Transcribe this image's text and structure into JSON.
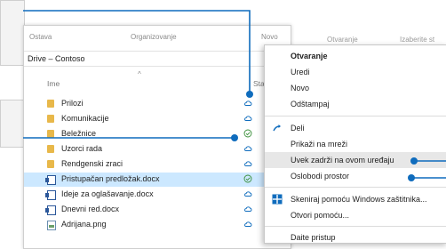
{
  "ribbon": {
    "items": [
      "Ostava",
      "Organizovanje",
      "Novo",
      "Otvaranje",
      "Izaberite st"
    ]
  },
  "address": {
    "path": "Drive – Contoso"
  },
  "columns": {
    "name": "Ime",
    "status": "Status"
  },
  "files": [
    {
      "name": "Prilozi",
      "type": "folder",
      "status": "cloud"
    },
    {
      "name": "Komunikacije",
      "type": "folder",
      "status": "cloud"
    },
    {
      "name": "Beležnice",
      "type": "folder",
      "status": "available"
    },
    {
      "name": "Uzorci rada",
      "type": "folder",
      "status": "cloud"
    },
    {
      "name": "Rendgenski zraci",
      "type": "folder",
      "status": "cloud"
    },
    {
      "name": "Pristupačan predložak.docx",
      "type": "docx",
      "status": "available",
      "selected": true
    },
    {
      "name": "Ideje za oglašavanje.docx",
      "type": "docx",
      "status": "cloud"
    },
    {
      "name": "Dnevni red.docx",
      "type": "docx",
      "status": "cloud"
    },
    {
      "name": "Adrijana.png",
      "type": "png",
      "status": "cloud"
    }
  ],
  "context_menu": {
    "items": [
      {
        "label": "Otvaranje",
        "bold": true
      },
      {
        "label": "Uredi"
      },
      {
        "label": "Novo"
      },
      {
        "label": "Odštampaj"
      },
      {
        "label": "Deli",
        "icon": "share-icon"
      },
      {
        "label": "Prikaži na mreži"
      },
      {
        "label": "Uvek zadrži na ovom uređaju",
        "highlighted": true
      },
      {
        "label": "Oslobodi prostor"
      },
      {
        "label": "Skeniraj pomoću Windows zaštitnika...",
        "icon": "defender-icon"
      },
      {
        "label": "Otvori pomoću..."
      },
      {
        "label": "Daite pristup"
      }
    ]
  },
  "colors": {
    "accent": "#0f6cbd",
    "selection": "#cce8ff",
    "cloud_status": "#0f6cbd",
    "available_status": "#3a8f3a",
    "folder": "#e8b84a"
  }
}
